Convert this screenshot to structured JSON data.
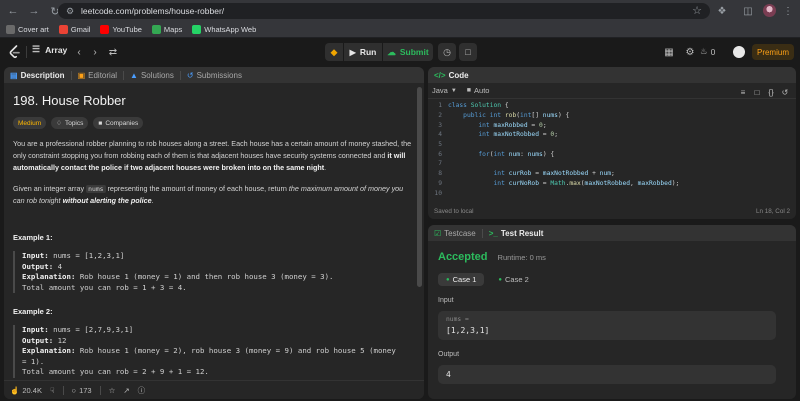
{
  "browser": {
    "url": "leetcode.com/problems/house-robber/",
    "bookmarks": [
      {
        "label": "Cover art",
        "color": "#6a6a6a"
      },
      {
        "label": "Gmail",
        "color": "#ea4335"
      },
      {
        "label": "YouTube",
        "color": "#ff0000"
      },
      {
        "label": "Maps",
        "color": "#34a853"
      },
      {
        "label": "WhatsApp Web",
        "color": "#25d366"
      }
    ]
  },
  "nav": {
    "problem_list_label": "Array",
    "run_label": "Run",
    "submit_label": "Submit",
    "streak_count": "0",
    "premium_label": "Premium"
  },
  "description": {
    "tabs": [
      "Description",
      "Editorial",
      "Solutions",
      "Submissions"
    ],
    "title": "198. House Robber",
    "difficulty": "Medium",
    "topics_label": "Topics",
    "companies_label": "Companies",
    "para1_a": "You are a professional robber planning to rob houses along a street. Each house has a certain amount of money stashed, the only constraint stopping you from robbing each of them is that adjacent houses have security systems connected and ",
    "para1_b": "it will automatically contact the police if two adjacent houses were broken into on the same night",
    "para1_c": ".",
    "para2_a": "Given an integer array ",
    "para2_code": "nums",
    "para2_b": " representing the amount of money of each house, return ",
    "para2_c": "the maximum amount of money you can rob tonight ",
    "para2_d": "without alerting the police",
    "para2_e": ".",
    "example1": {
      "title": "Example 1:",
      "input_key": "Input:",
      "input_val": " nums = [1,2,3,1]",
      "output_key": "Output:",
      "output_val": " 4",
      "expl_key": "Explanation:",
      "expl_val": " Rob house 1 (money = 1) and then rob house 3 (money = 3).",
      "expl_line2": "Total amount you can rob = 1 + 3 = 4."
    },
    "example2": {
      "title": "Example 2:",
      "input_key": "Input:",
      "input_val": " nums = [2,7,9,3,1]",
      "output_key": "Output:",
      "output_val": " 12",
      "expl_key": "Explanation:",
      "expl_val": " Rob house 1 (money = 2), rob house 3 (money = 9) and rob house 5 (money = 1).",
      "expl_line2": "Total amount you can rob = 2 + 9 + 1 = 12."
    },
    "footer": {
      "likes": "20.4K",
      "comments": "173"
    }
  },
  "code": {
    "tab_label": "Code",
    "language": "Java",
    "autocomplete": "Auto",
    "lines": [
      {
        "n": "1",
        "parts": [
          [
            "kw",
            "class "
          ],
          [
            "cls",
            "Solution"
          ],
          [
            "",
            " {"
          ]
        ]
      },
      {
        "n": "2",
        "parts": [
          [
            "",
            "    "
          ],
          [
            "kw",
            "public int "
          ],
          [
            "fn",
            "rob"
          ],
          [
            "",
            "("
          ],
          [
            "kw",
            "int"
          ],
          [
            "",
            "[] "
          ],
          [
            "var",
            "nums"
          ],
          [
            "",
            ") {"
          ]
        ]
      },
      {
        "n": "3",
        "parts": [
          [
            "",
            "        "
          ],
          [
            "kw",
            "int "
          ],
          [
            "var",
            "maxRobbed"
          ],
          [
            "",
            " = "
          ],
          [
            "num",
            "0"
          ],
          [
            "",
            ";"
          ]
        ]
      },
      {
        "n": "4",
        "parts": [
          [
            "",
            "        "
          ],
          [
            "kw",
            "int "
          ],
          [
            "var",
            "maxNotRobbed"
          ],
          [
            "",
            " = "
          ],
          [
            "num",
            "0"
          ],
          [
            "",
            ";"
          ]
        ]
      },
      {
        "n": "5",
        "parts": [
          [
            "",
            ""
          ]
        ]
      },
      {
        "n": "6",
        "parts": [
          [
            "",
            "        "
          ],
          [
            "kw",
            "for"
          ],
          [
            "",
            "("
          ],
          [
            "kw",
            "int "
          ],
          [
            "var",
            "num"
          ],
          [
            "",
            ": "
          ],
          [
            "var",
            "nums"
          ],
          [
            "",
            ") {"
          ]
        ]
      },
      {
        "n": "7",
        "parts": [
          [
            "",
            ""
          ]
        ]
      },
      {
        "n": "8",
        "parts": [
          [
            "",
            "            "
          ],
          [
            "kw",
            "int "
          ],
          [
            "var",
            "curRob"
          ],
          [
            "",
            " = "
          ],
          [
            "var",
            "maxNotRobbed"
          ],
          [
            "",
            " + "
          ],
          [
            "var",
            "num"
          ],
          [
            "",
            ";"
          ]
        ]
      },
      {
        "n": "9",
        "parts": [
          [
            "",
            "            "
          ],
          [
            "kw",
            "int "
          ],
          [
            "var",
            "curNoRob"
          ],
          [
            "",
            " = "
          ],
          [
            "cls",
            "Math"
          ],
          [
            "",
            "."
          ],
          [
            "fn",
            "max"
          ],
          [
            "",
            "("
          ],
          [
            "var",
            "maxNotRobbed"
          ],
          [
            "",
            ", "
          ],
          [
            "var",
            "maxRobbed"
          ],
          [
            "",
            ");"
          ]
        ]
      },
      {
        "n": "10",
        "parts": [
          [
            "",
            ""
          ]
        ]
      }
    ],
    "saved_text": "Saved to local",
    "cursor_pos": "Ln 18, Col 2"
  },
  "result": {
    "tabs": [
      "Testcase",
      "Test Result"
    ],
    "status": "Accepted",
    "runtime": "Runtime: 0 ms",
    "cases": [
      "Case 1",
      "Case 2"
    ],
    "input_label": "Input",
    "input_var": "nums =",
    "input_value": "[1,2,3,1]",
    "output_label": "Output",
    "output_value": "4"
  }
}
